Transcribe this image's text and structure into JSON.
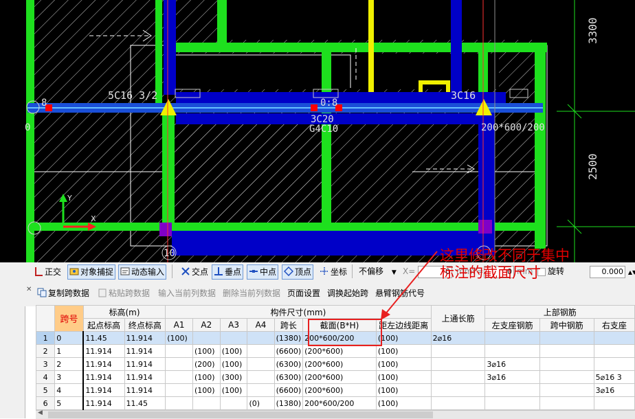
{
  "cad": {
    "labels": {
      "rebar_5c16": "5C16 3/2",
      "rebar_3c16": "3C16",
      "rebar_3c20": "3C20",
      "rebar_g4c10": "G4C10",
      "section_200": "200*600/200",
      "axis_0": "0",
      "axis_10": "10",
      "axis_8a": "8",
      "axis_8b": "0:8",
      "dim_3300": "3300",
      "dim_2500": "2500",
      "ucs_y": "Y",
      "ucs_x": "X"
    },
    "colors": {
      "background": "#000000",
      "wall_green": "#1ee01e",
      "beam_blue": "#0000c8",
      "beam_line": "#3399ff",
      "column_yellow": "#f0f000",
      "hatch": "#c8c8c8",
      "node_red": "#ff0000",
      "node_purple": "#8000c8",
      "dim_white": "#ffffff"
    }
  },
  "snap_toolbar": {
    "ortho": "正交",
    "object_snap": "对象捕捉",
    "dynamic_input": "动态输入",
    "intersection": "交点",
    "perpendicular": "垂点",
    "midpoint": "中点",
    "vertex": "顶点",
    "coordinate": "坐标",
    "offset_select": "不偏移",
    "x_label": "X=",
    "x_value": "0",
    "x_unit": "mm",
    "y_label": "Y=",
    "y_value": "0",
    "y_unit": "mm",
    "rotate_label": "旋转",
    "rotate_value": "0.000"
  },
  "table_toolbar": {
    "copy_span": "复制跨数据",
    "paste_span": "粘贴跨数据",
    "input_col": "输入当前列数据",
    "delete_col": "删除当前列数据",
    "page_setup": "页面设置",
    "swap_start": "调换起始跨",
    "cantilever_code": "悬臂钢筋代号"
  },
  "table": {
    "headers": {
      "span": "跨号",
      "elevation": "标高(m)",
      "start_elev": "起点标高",
      "end_elev": "终点标高",
      "member_size": "构件尺寸(mm)",
      "a1": "A1",
      "a2": "A2",
      "a3": "A3",
      "a4": "A4",
      "span_len": "跨长",
      "section": "截面(B*H)",
      "dist_left": "距左边线距离",
      "top_through": "上通长筋",
      "top_rebar": "上部钢筋",
      "left_support": "左支座钢筋",
      "mid_span": "跨中钢筋",
      "right_support": "右支座"
    },
    "rows": [
      {
        "n": "1",
        "span": "0",
        "start": "11.45",
        "end": "11.914",
        "a1": "(100)",
        "a2": "",
        "a3": "",
        "a4": "",
        "len": "(1380)",
        "section": "200*600/200",
        "dist": "(100)",
        "through": "2⌀16",
        "left": "",
        "mid": "",
        "right": ""
      },
      {
        "n": "2",
        "span": "1",
        "start": "11.914",
        "end": "11.914",
        "a1": "",
        "a2": "(100)",
        "a3": "(100)",
        "a4": "",
        "len": "(6600)",
        "section": "(200*600)",
        "dist": "(100)",
        "through": "",
        "left": "",
        "mid": "",
        "right": ""
      },
      {
        "n": "3",
        "span": "2",
        "start": "11.914",
        "end": "11.914",
        "a1": "",
        "a2": "(200)",
        "a3": "(100)",
        "a4": "",
        "len": "(6300)",
        "section": "(200*600)",
        "dist": "(100)",
        "through": "",
        "left": "3⌀16",
        "mid": "",
        "right": ""
      },
      {
        "n": "4",
        "span": "3",
        "start": "11.914",
        "end": "11.914",
        "a1": "",
        "a2": "(100)",
        "a3": "(300)",
        "a4": "",
        "len": "(6300)",
        "section": "(200*600)",
        "dist": "(100)",
        "through": "",
        "left": "3⌀16",
        "mid": "",
        "right": "5⌀16 3"
      },
      {
        "n": "5",
        "span": "4",
        "start": "11.914",
        "end": "11.914",
        "a1": "",
        "a2": "(100)",
        "a3": "(100)",
        "a4": "",
        "len": "(6600)",
        "section": "(200*600)",
        "dist": "(100)",
        "through": "",
        "left": "",
        "mid": "",
        "right": "3⌀16"
      },
      {
        "n": "6",
        "span": "5",
        "start": "11.914",
        "end": "11.45",
        "a1": "",
        "a2": "",
        "a3": "",
        "a4": "(0)",
        "len": "(1380)",
        "section": "200*600/200",
        "dist": "(100)",
        "through": "",
        "left": "",
        "mid": "",
        "right": ""
      }
    ]
  },
  "annotation": {
    "line1": "这里修改不同于集中",
    "line2": "标注的截面尺寸"
  }
}
